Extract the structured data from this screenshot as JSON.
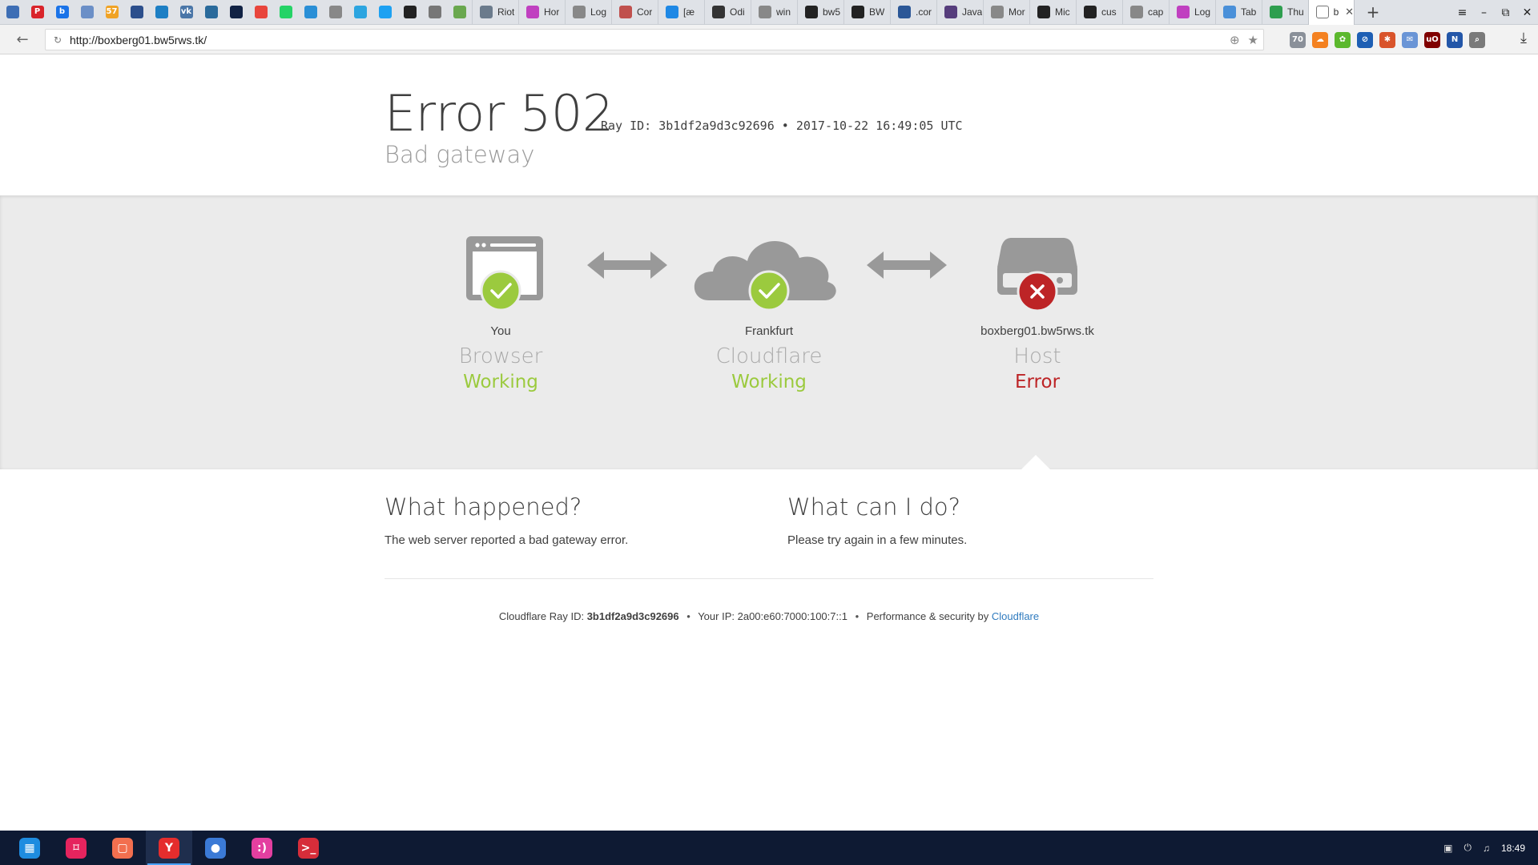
{
  "browser": {
    "pinned_tabs": [
      {
        "name": "pinned-tab-1",
        "icon": "document-icon",
        "glyph": "",
        "color": "#3d6eb5"
      },
      {
        "name": "pinned-tab-2",
        "icon": "p-logo-icon",
        "glyph": "P",
        "color": "#d9242b"
      },
      {
        "name": "pinned-tab-3",
        "icon": "b-logo-icon",
        "glyph": "b",
        "color": "#1a73e8"
      },
      {
        "name": "pinned-tab-4",
        "icon": "chart-icon",
        "glyph": "",
        "color": "#6b8fc7"
      },
      {
        "name": "pinned-tab-5",
        "icon": "57-logo-icon",
        "glyph": "57",
        "color": "#f0a326"
      },
      {
        "name": "pinned-tab-6",
        "icon": "grid-icon",
        "glyph": "",
        "color": "#2c4f8c"
      },
      {
        "name": "pinned-tab-7",
        "icon": "board-icon",
        "glyph": "",
        "color": "#1d7fc4"
      },
      {
        "name": "pinned-tab-8",
        "icon": "vk-icon",
        "glyph": "vk",
        "color": "#4a76a8"
      },
      {
        "name": "pinned-tab-9",
        "icon": "graph-icon",
        "glyph": "",
        "color": "#2a6a9b"
      },
      {
        "name": "pinned-tab-10",
        "icon": "circle-dark-icon",
        "glyph": "",
        "color": "#112244"
      },
      {
        "name": "pinned-tab-11",
        "icon": "gmail-icon",
        "glyph": "",
        "color": "#e8453c"
      },
      {
        "name": "pinned-tab-12",
        "icon": "whatsapp-icon",
        "glyph": "",
        "color": "#25d366"
      },
      {
        "name": "pinned-tab-13",
        "icon": "chat-bubble-icon",
        "glyph": "",
        "color": "#2a8fd6"
      },
      {
        "name": "pinned-tab-14",
        "icon": "page-icon",
        "glyph": "",
        "color": "#888888"
      },
      {
        "name": "pinned-tab-15",
        "icon": "telegram-icon",
        "glyph": "",
        "color": "#2ca5e0"
      },
      {
        "name": "pinned-tab-16",
        "icon": "twitter-icon",
        "glyph": "",
        "color": "#1da1f2"
      },
      {
        "name": "pinned-tab-17",
        "icon": "terminal-icon",
        "glyph": "",
        "color": "#222222"
      },
      {
        "name": "pinned-tab-18",
        "icon": "diamond-icon",
        "glyph": "",
        "color": "#777777"
      },
      {
        "name": "pinned-tab-19",
        "icon": "tree-icon",
        "glyph": "",
        "color": "#6aa84f"
      }
    ],
    "tabs": [
      {
        "name": "tab-riot",
        "label": "Riot",
        "icon": "riot-icon",
        "color": "#6b7b8c"
      },
      {
        "name": "tab-hor",
        "label": "Hor",
        "icon": "rainbow-icon",
        "color": "#c040c0"
      },
      {
        "name": "tab-log-1",
        "label": "Log",
        "icon": "page-icon",
        "color": "#888888"
      },
      {
        "name": "tab-cor",
        "label": "Cor",
        "icon": "spiral-icon",
        "color": "#c0504d"
      },
      {
        "name": "tab-bracket",
        "label": "[æ",
        "icon": "swirl-icon",
        "color": "#1e88e5"
      },
      {
        "name": "tab-odi",
        "label": "Odi",
        "icon": "code-icon",
        "color": "#333333"
      },
      {
        "name": "tab-win",
        "label": "win",
        "icon": "page-icon",
        "color": "#888888"
      },
      {
        "name": "tab-bw5",
        "label": "bw5",
        "icon": "s-square-icon",
        "color": "#222222"
      },
      {
        "name": "tab-bw",
        "label": "BW",
        "icon": "s-square-icon",
        "color": "#222222"
      },
      {
        "name": "tab-cor-2",
        "label": ".cor",
        "icon": "moon-icon",
        "color": "#2b5797"
      },
      {
        "name": "tab-java",
        "label": "Java",
        "icon": "bootstrap-icon",
        "color": "#563d7c"
      },
      {
        "name": "tab-mor",
        "label": "Mor",
        "icon": "page-icon",
        "color": "#888888"
      },
      {
        "name": "tab-mic",
        "label": "Mic",
        "icon": "github-icon",
        "color": "#222222"
      },
      {
        "name": "tab-cus",
        "label": "cus",
        "icon": "github-icon",
        "color": "#222222"
      },
      {
        "name": "tab-cap",
        "label": "cap",
        "icon": "page-icon",
        "color": "#888888"
      },
      {
        "name": "tab-log-2",
        "label": "Log",
        "icon": "rainbow-icon",
        "color": "#c040c0"
      },
      {
        "name": "tab-tab",
        "label": "Tab",
        "icon": "link-icon",
        "color": "#4a90d9"
      },
      {
        "name": "tab-thu",
        "label": "Thu",
        "icon": "n-logo-icon",
        "color": "#2e9e4f"
      }
    ],
    "active_tab": {
      "label": "b",
      "icon": "page-icon",
      "close": "✕"
    },
    "new_tab": "+",
    "window_controls": {
      "menu": "≡",
      "minimize": "–",
      "restore": "⧉",
      "close": "✕"
    },
    "url": "http://boxberg01.bw5rws.tk/",
    "back": "←",
    "reload": "↻",
    "extensions": [
      {
        "name": "ext-shield",
        "glyph": "70",
        "color": "#8a9099"
      },
      {
        "name": "ext-cloud",
        "glyph": "☁",
        "color": "#f48120"
      },
      {
        "name": "ext-leaf",
        "glyph": "✿",
        "color": "#5cb82e"
      },
      {
        "name": "ext-block",
        "glyph": "⊘",
        "color": "#1e5fb4"
      },
      {
        "name": "ext-bug",
        "glyph": "✱",
        "color": "#d9542b"
      },
      {
        "name": "ext-mail",
        "glyph": "✉",
        "color": "#6a95d6"
      },
      {
        "name": "ext-ublock",
        "glyph": "uO",
        "color": "#800000"
      },
      {
        "name": "ext-n",
        "glyph": "N",
        "color": "#2356a8"
      },
      {
        "name": "ext-search",
        "glyph": "⌕",
        "color": "#7a7a7a"
      }
    ],
    "download": "⤓"
  },
  "page": {
    "error_title": "Error 502",
    "ray_header": "Ray ID: 3b1df2a9d3c92696 • 2017-10-22 16:49:05 UTC",
    "error_subtitle": "Bad gateway",
    "nodes": [
      {
        "name": "browser",
        "location": "You",
        "role": "Browser",
        "status": "Working",
        "ok": true
      },
      {
        "name": "cloudflare",
        "location": "Frankfurt",
        "role": "Cloudflare",
        "status": "Working",
        "ok": true
      },
      {
        "name": "host",
        "location": "boxberg01.bw5rws.tk",
        "role": "Host",
        "status": "Error",
        "ok": false
      }
    ],
    "what_happened": {
      "heading": "What happened?",
      "text": "The web server reported a bad gateway error."
    },
    "what_can_i_do": {
      "heading": "What can I do?",
      "text": "Please try again in a few minutes."
    },
    "footer": {
      "ray_label": "Cloudflare Ray ID:",
      "ray_id": "3b1df2a9d3c92696",
      "ip_label": "Your IP:",
      "ip": "2a00:e60:7000:100:7::1",
      "perf_label": "Performance & security by",
      "perf_link": "Cloudflare",
      "bullet": "•"
    },
    "colors": {
      "ok": "#9bca3e",
      "error": "#bd2426",
      "icon_gray": "#999999",
      "link": "#2f7bbf"
    }
  },
  "taskbar": {
    "apps": [
      {
        "name": "taskbar-start",
        "icon": "start-icon",
        "glyph": "▦",
        "color": "#1e8ce0"
      },
      {
        "name": "taskbar-screenshot",
        "icon": "crop-icon",
        "glyph": "⌑",
        "color": "#e5245e"
      },
      {
        "name": "taskbar-chat",
        "icon": "chat-icon",
        "glyph": "▢",
        "color": "#f26f4f"
      },
      {
        "name": "taskbar-yandex",
        "icon": "yandex-browser-icon",
        "glyph": "Y",
        "color": "#e52d2d"
      },
      {
        "name": "taskbar-globe",
        "icon": "globe-icon",
        "glyph": "●",
        "color": "#3b7ad6"
      },
      {
        "name": "taskbar-messenger",
        "icon": "messenger-icon",
        "glyph": ":)",
        "color": "#e33fa0"
      },
      {
        "name": "taskbar-terminal",
        "icon": "terminal-icon",
        "glyph": ">_",
        "color": "#d62d3a"
      }
    ],
    "active_index": 3,
    "time": "18:49"
  }
}
